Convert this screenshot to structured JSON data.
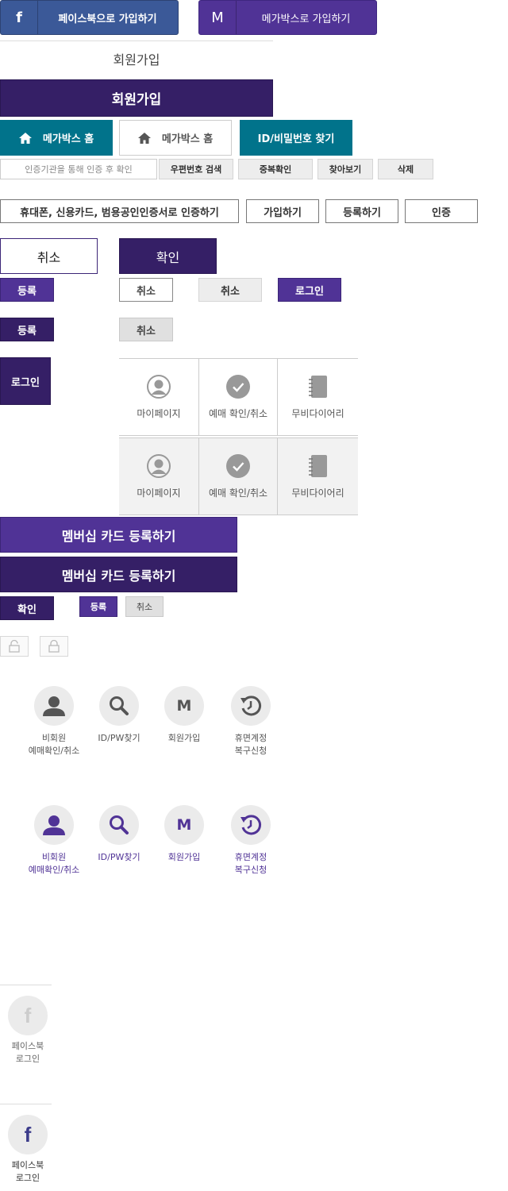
{
  "sns": {
    "facebook_icon": "f",
    "facebook_label": "페이스북으로 가입하기",
    "megabox_icon": "M",
    "megabox_label": "메가박스로 가입하기"
  },
  "signup_title_plain": "회원가입",
  "signup_title_bar": "회원가입",
  "home_teal": "메가박스 홈",
  "home_outline": "메가박스 홈",
  "find_id": "ID/비밀번호 찾기",
  "cert_placeholder": "인증기관을 통해 인증 후 확인",
  "zip_search": "우편번호 검색",
  "dup_check": "중복확인",
  "browse": "찾아보기",
  "delete": "삭제",
  "verify_options": "휴대폰, 신용카드, 범용공인인증서로 인증하기",
  "join": "가입하기",
  "register": "등록하기",
  "auth": "인증",
  "cancel_large": "취소",
  "confirm_large": "확인",
  "reg_small_1": "등록",
  "cancel_small_1": "취소",
  "cancel_small_2": "취소",
  "login_small": "로그인",
  "reg_small_2": "등록",
  "cancel_small_3": "취소",
  "login_tall": "로그인",
  "quickmenu": [
    {
      "label": "마이페이지",
      "icon": "user-icon"
    },
    {
      "label": "예매 확인/취소",
      "icon": "check-icon"
    },
    {
      "label": "무비다이어리",
      "icon": "notebook-icon"
    }
  ],
  "quickmenu_active": [
    {
      "label": "마이페이지",
      "icon": "user-icon"
    },
    {
      "label": "예매 확인/취소",
      "icon": "check-icon"
    },
    {
      "label": "무비다이어리",
      "icon": "notebook-icon"
    }
  ],
  "membership_1": "멤버십 카드 등록하기",
  "membership_2": "멤버십 카드 등록하기",
  "confirm_small": "확인",
  "reg_mini": "등록",
  "cancel_mini": "취소",
  "circle_menu": [
    {
      "label": "비회원\n예매확인/취소",
      "icon": "user-icon"
    },
    {
      "label": "ID/PW찾기",
      "icon": "search-icon"
    },
    {
      "label": "회원가입",
      "icon": "megabox-m-icon",
      "glyph": "M"
    },
    {
      "label": "휴면계정\n복구신청",
      "icon": "restore-icon"
    }
  ],
  "circle_menu_active": [
    {
      "label": "비회원\n예매확인/취소",
      "icon": "user-icon"
    },
    {
      "label": "ID/PW찾기",
      "icon": "search-icon"
    },
    {
      "label": "회원가입",
      "icon": "megabox-m-icon",
      "glyph": "M"
    },
    {
      "label": "휴면계정\n복구신청",
      "icon": "restore-icon"
    }
  ],
  "fb_login": {
    "glyph": "f",
    "label": "페이스북\n로그인"
  },
  "fb_login_active": {
    "glyph": "f",
    "label": "페이스북\n로그인"
  },
  "colors": {
    "purple": "#503396",
    "dark_purple": "#351f66",
    "teal": "#01738b",
    "facebook": "#3b5998"
  }
}
